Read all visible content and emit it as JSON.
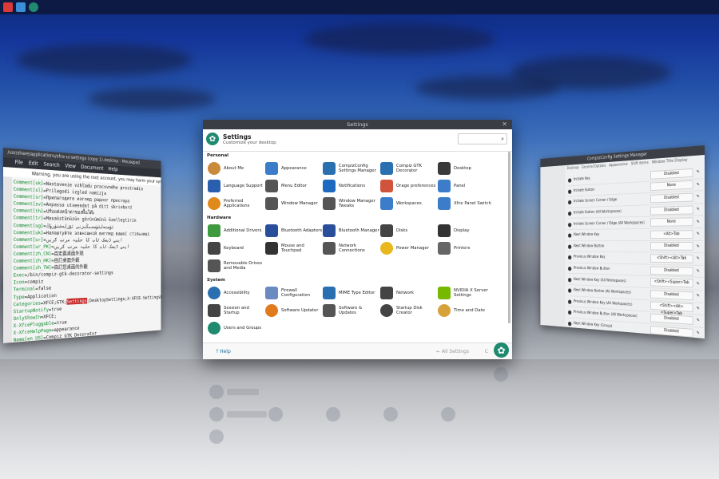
{
  "colors": {
    "accent": "#1f8a6f",
    "panel": "#0d1a44",
    "link": "#1a6ea8"
  },
  "mousepad": {
    "title": "/usr/share/applications/xfce-ui-settings (copy 1).desktop - Mousepad",
    "menu": [
      "File",
      "Edit",
      "Search",
      "View",
      "Document",
      "Help"
    ],
    "warning": "Warning, you are using the root account, you may harm your system.",
    "lines": [
      {
        "k": "Comment[sk]",
        "v": "=Nastavenie vzhľadu pracovného prostredia"
      },
      {
        "k": "Comment[sl]",
        "v": "=Prilagodi izgled namizja"
      },
      {
        "k": "Comment[sr]",
        "v": "=Прилагодите изглед радног простора"
      },
      {
        "k": "Comment[sv]",
        "v": "=Anpassa utseendet på ditt skrivbord"
      },
      {
        "k": "Comment[th]",
        "v": "=ปรับแต่งหน้าตาของพื้นโต๊ะ"
      },
      {
        "k": "Comment[tr]",
        "v": "=Masaüstünüzün görünümünü özelleştirin"
      },
      {
        "k": "Comment[ug]",
        "v": "=ئۈستەلئۈستىڭىزنى ئۆزلەشتۈرۈڭ"
      },
      {
        "k": "Comment[uk]",
        "v": "=Налаштуйте зовнішній вигляд вашої стільниці"
      },
      {
        "k": "Comment[ur]",
        "v": "=اپنے ڈیسک ٹاپ کا حلیہ مرتب کریں"
      },
      {
        "k": "Comment[ur_PK]",
        "v": "=اپنے ڈیسک ٹاپ کا حلیہ مرتب کریں"
      },
      {
        "k": "Comment[zh_CN]",
        "v": "=自定義桌面外观"
      },
      {
        "k": "Comment[zh_HK]",
        "v": "=自訂桌面外觀"
      },
      {
        "k": "Comment[zh_TW]",
        "v": "=自訂您桌面的外觀"
      },
      {
        "k": "Exec",
        "v": "=/bin/compiz-gtk-decorator-settings"
      },
      {
        "k": "Icon",
        "v": "=compiz"
      },
      {
        "k": "Terminal",
        "v": "=false"
      },
      {
        "k": "Type",
        "v": "=Application"
      },
      {
        "k": "Categories",
        "v": "=XFCE;GTK;",
        "hl": "Settings",
        "rest": ";DesktopSettings;X-XFCE-SettingsDialog;X-XFCE-Perso"
      },
      {
        "k": "StartupNotify",
        "v": "=true"
      },
      {
        "k": "OnlyShowIn",
        "v": "=XFCE;"
      },
      {
        "k": "X-XfcePluggable",
        "v": "=true"
      },
      {
        "k": "X-XfceHelpPage",
        "v": "=appearance"
      },
      {
        "k": "Name[en_US]",
        "v": "=Compiz GTK Decorator"
      }
    ]
  },
  "ccsm": {
    "title": "CompizConfig Settings Manager",
    "tabs": [
      "Desktop",
      "General Options",
      "Appearance",
      "Shift Items",
      "Window Title Display"
    ],
    "rows": [
      {
        "name": "Initiate Key",
        "value": "Disabled"
      },
      {
        "name": "Initiate Button",
        "value": "None"
      },
      {
        "name": "Initiate Screen Corner / Edge",
        "value": "Disabled"
      },
      {
        "name": "Initiate Button (All Workspaces)",
        "value": "Disabled"
      },
      {
        "name": "Initiate Screen Corner / Edge (All Workspaces)",
        "value": "None"
      },
      {
        "name": "Next Window Key",
        "value": "<Alt>Tab"
      },
      {
        "name": "Next Window Button",
        "value": "Disabled"
      },
      {
        "name": "Previous Window Key",
        "value": "<Shift><Alt>Tab"
      },
      {
        "name": "Previous Window Button",
        "value": "Disabled"
      },
      {
        "name": "Next Window Key (All Workspaces)",
        "value": "<Shift><Super>Tab"
      },
      {
        "name": "Next Window Button (All Workspaces)",
        "value": "Disabled"
      },
      {
        "name": "Previous Window Key (All Workspaces)",
        "value": "<Shift><Alt><Super>Tab"
      },
      {
        "name": "Previous Window Button (All Workspaces)",
        "value": "Disabled"
      },
      {
        "name": "Next Window Key (Group)",
        "value": "Disabled"
      }
    ]
  },
  "settings": {
    "window_title": "Settings",
    "title": "Settings",
    "subtitle": "Customize your desktop",
    "categories": {
      "personal": "Personal",
      "hardware": "Hardware",
      "system": "System"
    },
    "personal": [
      {
        "label": "About Me",
        "icon": "person-icon",
        "color": "#c98a3b"
      },
      {
        "label": "Appearance",
        "icon": "appearance-icon",
        "color": "#3b7dc9"
      },
      {
        "label": "CompizConfig Settings Manager",
        "icon": "compizconfig-icon",
        "color": "#2a6fb0"
      },
      {
        "label": "Compiz GTK Decorator",
        "icon": "compiz-gtk-icon",
        "color": "#2a6fb0"
      },
      {
        "label": "Desktop",
        "icon": "desktop-icon",
        "color": "#3a3a3a"
      },
      {
        "label": "Language Support",
        "icon": "language-icon",
        "color": "#2a5fb0"
      },
      {
        "label": "Menu Editor",
        "icon": "menu-editor-icon",
        "color": "#555"
      },
      {
        "label": "Notifications",
        "icon": "notifications-icon",
        "color": "#1c6ac0"
      },
      {
        "label": "Orage preferences",
        "icon": "calendar-icon",
        "color": "#d0543b"
      },
      {
        "label": "Panel",
        "icon": "panel-icon",
        "color": "#3b7dc9"
      },
      {
        "label": "Preferred Applications",
        "icon": "star-icon",
        "color": "#e08a1c"
      },
      {
        "label": "Window Manager",
        "icon": "window-manager-icon",
        "color": "#555"
      },
      {
        "label": "Window Manager Tweaks",
        "icon": "wm-tweaks-icon",
        "color": "#555"
      },
      {
        "label": "Workspaces",
        "icon": "workspaces-icon",
        "color": "#3b7dc9"
      },
      {
        "label": "Xfce Panel Switch",
        "icon": "panel-switch-icon",
        "color": "#3b7dc9"
      }
    ],
    "hardware": [
      {
        "label": "Additional Drivers",
        "icon": "drivers-icon",
        "color": "#3f9a3f"
      },
      {
        "label": "Bluetooth Adapters",
        "icon": "bluetooth-icon",
        "color": "#2a4f9a"
      },
      {
        "label": "Bluetooth Manager",
        "icon": "bluetooth-icon",
        "color": "#2a4f9a"
      },
      {
        "label": "Disks",
        "icon": "disks-icon",
        "color": "#444"
      },
      {
        "label": "Display",
        "icon": "display-icon",
        "color": "#333"
      },
      {
        "label": "Keyboard",
        "icon": "keyboard-icon",
        "color": "#444"
      },
      {
        "label": "Mouse and Touchpad",
        "icon": "mouse-icon",
        "color": "#333"
      },
      {
        "label": "Network Connections",
        "icon": "network-icon",
        "color": "#555"
      },
      {
        "label": "Power Manager",
        "icon": "power-icon",
        "color": "#e8b81c"
      },
      {
        "label": "Printers",
        "icon": "printer-icon",
        "color": "#666"
      },
      {
        "label": "Removable Drives and Media",
        "icon": "removable-drives-icon",
        "color": "#555"
      }
    ],
    "system": [
      {
        "label": "Accessibility",
        "icon": "accessibility-icon",
        "color": "#2a6fb0"
      },
      {
        "label": "Firewall Configuration",
        "icon": "firewall-icon",
        "color": "#6a8ac0"
      },
      {
        "label": "MIME Type Editor",
        "icon": "mime-icon",
        "color": "#2a6fb0"
      },
      {
        "label": "Network",
        "icon": "network-icon",
        "color": "#444"
      },
      {
        "label": "NVIDIA X Server Settings",
        "icon": "nvidia-icon",
        "color": "#76b900"
      },
      {
        "label": "Session and Startup",
        "icon": "session-icon",
        "color": "#444"
      },
      {
        "label": "Software Updater",
        "icon": "updater-icon",
        "color": "#e07a1c"
      },
      {
        "label": "Software & Updates",
        "icon": "software-icon",
        "color": "#555"
      },
      {
        "label": "Startup Disk Creator",
        "icon": "startup-disk-icon",
        "color": "#444"
      },
      {
        "label": "Time and Date",
        "icon": "clock-icon",
        "color": "#d8a23b"
      },
      {
        "label": "Users and Groups",
        "icon": "users-icon",
        "color": "#1f8a6f"
      }
    ],
    "footer": {
      "help": "Help",
      "all": "All Settings",
      "close": "C"
    }
  }
}
